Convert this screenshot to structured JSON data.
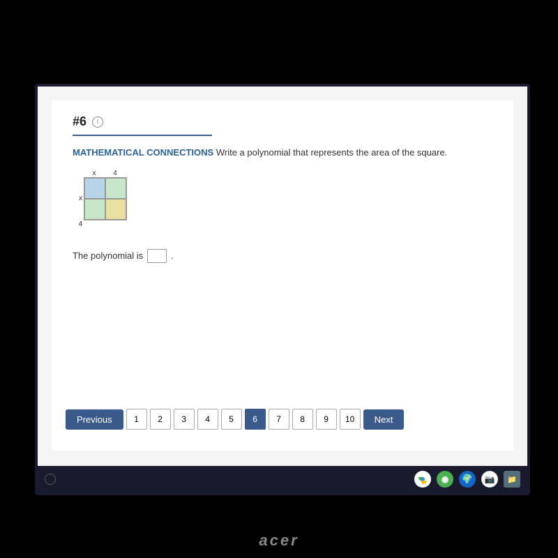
{
  "monitor": {
    "brand": "acer"
  },
  "question": {
    "number": "#6",
    "info_label": "i",
    "label": "MATHEMATICAL CONNECTIONS",
    "prompt": "Write a polynomial that represents the area of the square.",
    "answer_prefix": "The polynomial is",
    "answer_suffix": "."
  },
  "diagram": {
    "top_labels": [
      "x",
      "4"
    ],
    "side_labels": [
      "x",
      "4"
    ],
    "cells": [
      "tl",
      "tr",
      "bl",
      "br"
    ]
  },
  "pagination": {
    "previous_label": "Previous",
    "next_label": "Next",
    "pages": [
      "1",
      "2",
      "3",
      "4",
      "5",
      "6",
      "7",
      "8",
      "9",
      "10"
    ],
    "active_page": "6"
  },
  "taskbar": {
    "circle_label": "home"
  }
}
